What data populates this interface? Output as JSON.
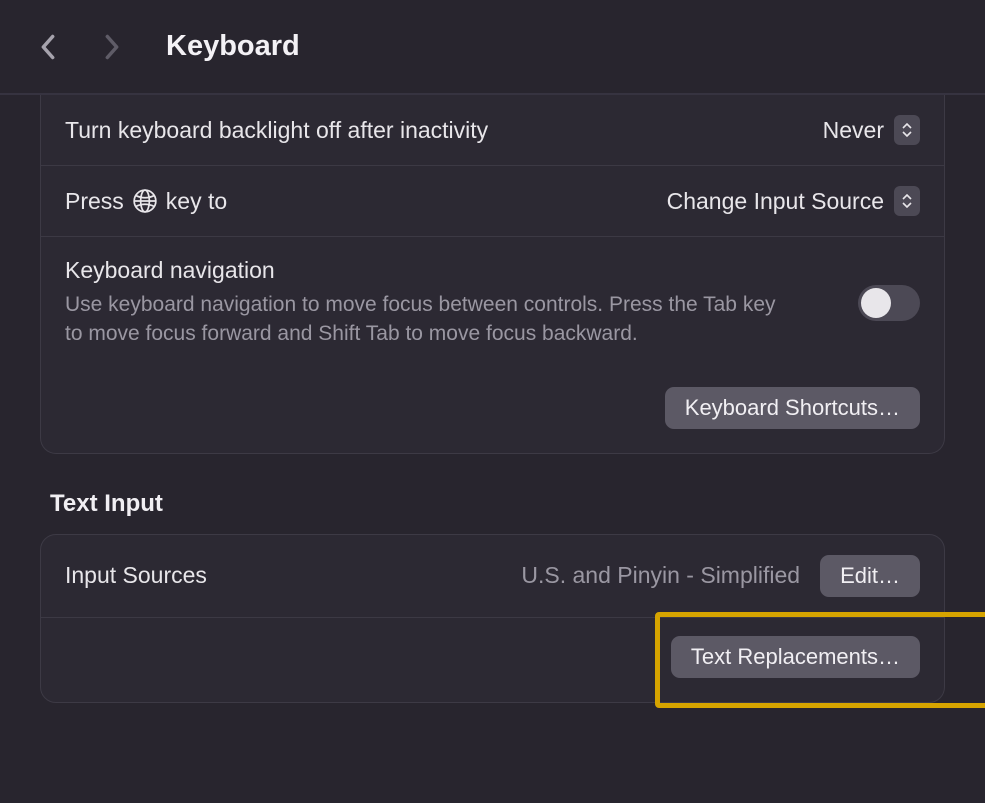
{
  "header": {
    "title": "Keyboard"
  },
  "settings": {
    "backlight": {
      "label": "Turn keyboard backlight off after inactivity",
      "value": "Never"
    },
    "globekey": {
      "label_prefix": "Press ",
      "label_suffix": " key to",
      "value": "Change Input Source"
    },
    "navigation": {
      "label": "Keyboard navigation",
      "description": "Use keyboard navigation to move focus between controls. Press the Tab key to move focus forward and Shift Tab to move focus backward."
    },
    "shortcuts_button": "Keyboard Shortcuts…"
  },
  "text_input": {
    "section_title": "Text Input",
    "input_sources": {
      "label": "Input Sources",
      "value": "U.S. and Pinyin - Simplified",
      "edit_button": "Edit…"
    },
    "text_replacements_button": "Text Replacements…"
  }
}
